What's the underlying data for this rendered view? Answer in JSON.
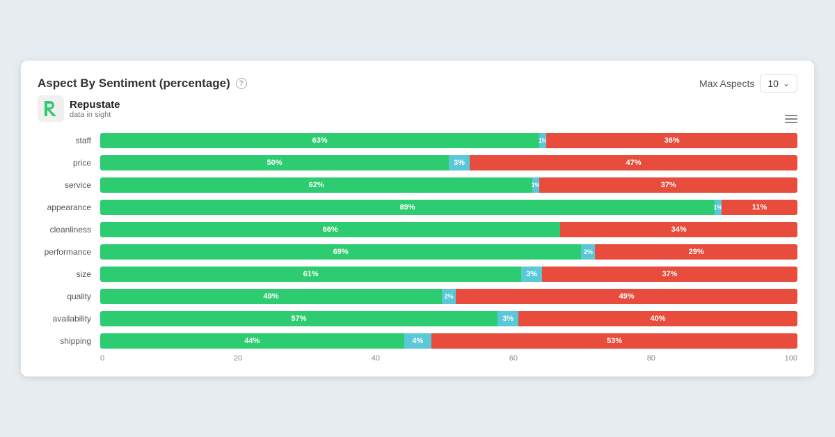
{
  "header": {
    "title": "Aspect By Sentiment (percentage)",
    "help_label": "?",
    "max_aspects_label": "Max Aspects",
    "max_aspects_value": "10",
    "menu_icon": "≡"
  },
  "logo": {
    "name": "Repustate",
    "tagline": "data in sight"
  },
  "x_axis": {
    "labels": [
      "0",
      "20",
      "40",
      "60",
      "80",
      "100"
    ]
  },
  "bars": [
    {
      "label": "staff",
      "green": 63,
      "blue": 1,
      "red": 36
    },
    {
      "label": "price",
      "green": 50,
      "blue": 3,
      "red": 47
    },
    {
      "label": "service",
      "green": 62,
      "blue": 1,
      "red": 37
    },
    {
      "label": "appearance",
      "green": 89,
      "blue": 1,
      "red": 11
    },
    {
      "label": "cleanliness",
      "green": 66,
      "blue": 0,
      "red": 34
    },
    {
      "label": "performance",
      "green": 69,
      "blue": 2,
      "red": 29
    },
    {
      "label": "size",
      "green": 61,
      "blue": 3,
      "red": 37
    },
    {
      "label": "quality",
      "green": 49,
      "blue": 2,
      "red": 49
    },
    {
      "label": "availability",
      "green": 57,
      "blue": 3,
      "red": 40
    },
    {
      "label": "shipping",
      "green": 44,
      "blue": 4,
      "red": 53
    }
  ]
}
